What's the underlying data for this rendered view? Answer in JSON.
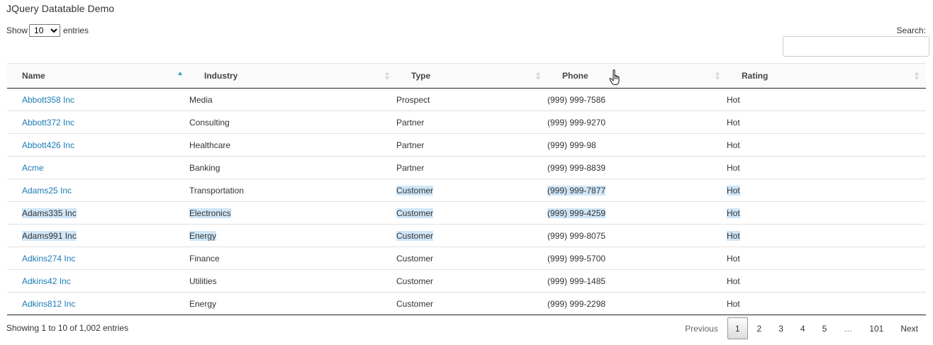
{
  "page": {
    "title": "JQuery Datatable Demo"
  },
  "length": {
    "prefix": "Show",
    "value": "10",
    "options": [
      "10"
    ],
    "suffix": "entries"
  },
  "search": {
    "label": "Search:",
    "value": ""
  },
  "table": {
    "columns": [
      {
        "key": "name",
        "label": "Name",
        "sort": "asc"
      },
      {
        "key": "industry",
        "label": "Industry",
        "sort": "none"
      },
      {
        "key": "type",
        "label": "Type",
        "sort": "none"
      },
      {
        "key": "phone",
        "label": "Phone",
        "sort": "none"
      },
      {
        "key": "rating",
        "label": "Rating",
        "sort": "none"
      }
    ],
    "rows": [
      {
        "name": "Abbott358 Inc",
        "industry": "Media",
        "type": "Prospect",
        "phone": "(999) 999-7586",
        "rating": "Hot"
      },
      {
        "name": "Abbott372 Inc",
        "industry": "Consulting",
        "type": "Partner",
        "phone": "(999) 999-9270",
        "rating": "Hot"
      },
      {
        "name": "Abbott426 Inc",
        "industry": "Healthcare",
        "type": "Partner",
        "phone": "(999) 999-98",
        "rating": "Hot"
      },
      {
        "name": "Acme",
        "industry": "Banking",
        "type": "Partner",
        "phone": "(999) 999-8839",
        "rating": "Hot"
      },
      {
        "name": "Adams25 Inc",
        "industry": "Transportation",
        "type": "Customer",
        "phone": "(999) 999-7877",
        "rating": "Hot"
      },
      {
        "name": "Adams335 Inc",
        "industry": "Electronics",
        "type": "Customer",
        "phone": "(999) 999-4259",
        "rating": "Hot"
      },
      {
        "name": "Adams991 Inc",
        "industry": "Energy",
        "type": "Customer",
        "phone": "(999) 999-8075",
        "rating": "Hot"
      },
      {
        "name": "Adkins274 Inc",
        "industry": "Finance",
        "type": "Customer",
        "phone": "(999) 999-5700",
        "rating": "Hot"
      },
      {
        "name": "Adkins42 Inc",
        "industry": "Utilities",
        "type": "Customer",
        "phone": "(999) 999-1485",
        "rating": "Hot"
      },
      {
        "name": "Adkins812 Inc",
        "industry": "Energy",
        "type": "Customer",
        "phone": "(999) 999-2298",
        "rating": "Hot"
      }
    ]
  },
  "info": {
    "text": "Showing 1 to 10 of 1,002 entries"
  },
  "pagination": {
    "previous": "Previous",
    "pages": [
      "1",
      "2",
      "3",
      "4",
      "5"
    ],
    "current": "1",
    "ellipsis": "…",
    "last": "101",
    "next": "Next"
  },
  "colors": {
    "link": "#1a7bb5",
    "selection": "#cfe6f8",
    "sort_active": "#3b9ad9"
  },
  "icons": {
    "cursor": "hand-pointer-icon",
    "sort": "sort-arrows-icon"
  }
}
